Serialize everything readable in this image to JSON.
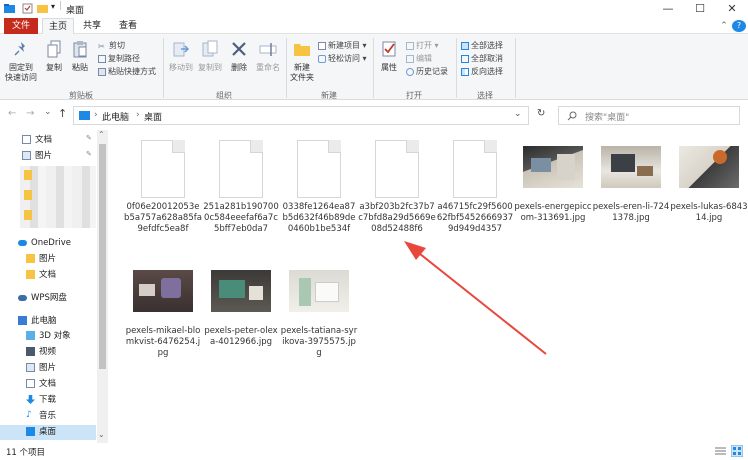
{
  "window": {
    "title": "桌面",
    "minimize": "—",
    "maximize": "☐",
    "close": "✕"
  },
  "tabs": {
    "file": "文件",
    "home": "主页",
    "share": "共享",
    "view": "查看",
    "collapse": "⌃",
    "help": "?"
  },
  "ribbon": {
    "clipboard": {
      "pin_line1": "固定到",
      "pin_line2": "快速访问",
      "copy": "复制",
      "paste": "粘贴",
      "cut": "剪切",
      "copy_path": "复制路径",
      "paste_shortcut": "粘贴快捷方式",
      "label": "剪贴板"
    },
    "organize": {
      "move_to": "移动到",
      "copy_to": "复制到",
      "delete": "删除",
      "rename": "重命名",
      "label": "组织"
    },
    "new": {
      "new_folder_line1": "新建",
      "new_folder_line2": "文件夹",
      "new_item": "新建项目 ▾",
      "easy_access": "轻松访问 ▾",
      "label": "新建"
    },
    "open": {
      "properties": "属性",
      "open": "打开 ▾",
      "edit": "编辑",
      "history": "历史记录",
      "label": "打开"
    },
    "select": {
      "select_all": "全部选择",
      "select_none": "全部取消",
      "invert": "反向选择",
      "label": "选择"
    }
  },
  "address": {
    "back": "←",
    "forward": "→",
    "dropdown": "⌄",
    "up": "↑",
    "path": [
      "此电脑",
      "桌面"
    ],
    "sep": "›",
    "refresh": "↻",
    "search_placeholder": "搜索\"桌面\"",
    "history_dropdown": "⌄"
  },
  "sidebar": {
    "items": [
      {
        "label": "文档",
        "icon": "document-icon",
        "pin": true
      },
      {
        "label": "图片",
        "icon": "picture-icon",
        "pin": true
      },
      {
        "label": "OneDrive",
        "icon": "cloud-icon"
      },
      {
        "label": "图片",
        "icon": "folder-icon"
      },
      {
        "label": "文档",
        "icon": "folder-icon"
      },
      {
        "label": "WPS网盘",
        "icon": "cloud-icon"
      },
      {
        "label": "此电脑",
        "icon": "computer-icon"
      },
      {
        "label": "3D 对象",
        "icon": "cube-icon"
      },
      {
        "label": "视频",
        "icon": "video-icon"
      },
      {
        "label": "图片",
        "icon": "picture-icon"
      },
      {
        "label": "文档",
        "icon": "document-icon"
      },
      {
        "label": "下载",
        "icon": "download-icon"
      },
      {
        "label": "音乐",
        "icon": "music-icon"
      },
      {
        "label": "桌面",
        "icon": "desktop-icon"
      }
    ],
    "pin_glyph": "📌",
    "scroll_up": "⌃",
    "scroll_down": "⌄"
  },
  "files": [
    {
      "name": "0f06e20012053eb5a757a628a85fa9efdfc5ea8f",
      "type": "blank"
    },
    {
      "name": "251a281b1907000c584eeefaf6a7c5bff7eb0da7",
      "type": "blank"
    },
    {
      "name": "0338fe1264ea87b5d632f46b89de0460b1be534f",
      "type": "blank"
    },
    {
      "name": "a3bf203b2fc37b7c7bfd8a29d5669e08d52488f6",
      "type": "blank"
    },
    {
      "name": "a46715fc29f560062fbf54526669379d949d4357",
      "type": "blank"
    },
    {
      "name": "pexels-energepiccom-313691.jpg",
      "type": "photo"
    },
    {
      "name": "pexels-eren-li-7241378.jpg",
      "type": "photo"
    },
    {
      "name": "pexels-lukas-684314.jpg",
      "type": "photo"
    },
    {
      "name": "pexels-mikael-blomkvist-6476254.jpg",
      "type": "photo"
    },
    {
      "name": "pexels-peter-olexa-4012966.jpg",
      "type": "photo"
    },
    {
      "name": "pexels-tatiana-syrikova-3975575.jpg",
      "type": "photo"
    }
  ],
  "status": {
    "count": "11 个项目"
  },
  "colors": {
    "file_tab": "#c42b1c",
    "arrow": "#e8473c",
    "accent": "#0078d7"
  }
}
